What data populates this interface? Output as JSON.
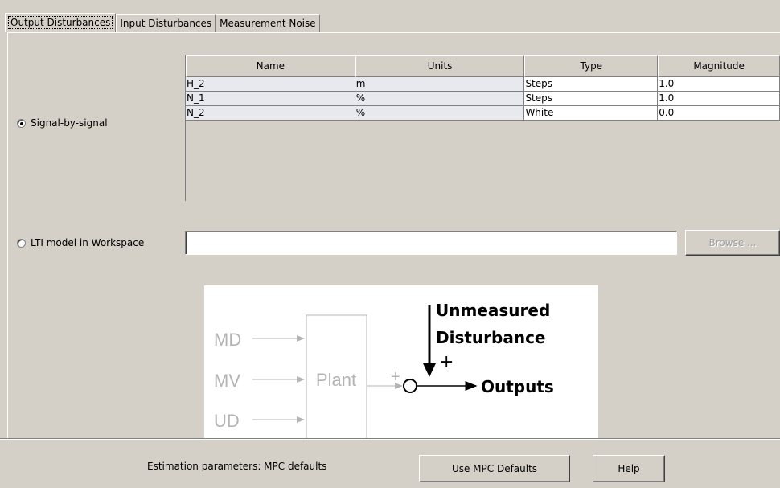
{
  "tabs": [
    {
      "label": "Output Disturbances",
      "active": true
    },
    {
      "label": "Input Disturbances",
      "active": false
    },
    {
      "label": "Measurement Noise",
      "active": false
    }
  ],
  "signal_option": {
    "label": "Signal-by-signal",
    "selected": true
  },
  "lti_option": {
    "label": "LTI model in Workspace",
    "selected": false
  },
  "table": {
    "columns": [
      "Name",
      "Units",
      "Type",
      "Magnitude"
    ],
    "rows": [
      [
        "H_2",
        "m",
        "Steps",
        "1.0"
      ],
      [
        "N_1",
        "%",
        "Steps",
        "1.0"
      ],
      [
        "N_2",
        "%",
        "White",
        "0.0"
      ]
    ]
  },
  "workspace_field": {
    "value": ""
  },
  "browse_button": {
    "label": "Browse ...",
    "enabled": false
  },
  "diagram": {
    "inputs": [
      "MD",
      "MV",
      "UD"
    ],
    "plant_label": "Plant",
    "plus_left": "+",
    "plus_top": "+",
    "disturbance_line1": "Unmeasured",
    "disturbance_line2": "Disturbance",
    "outputs_label": "Outputs"
  },
  "footer": {
    "estimation_label": "Estimation parameters:  MPC defaults",
    "use_defaults_button": "Use MPC Defaults",
    "help_button": "Help"
  },
  "colors": {
    "dialog_bg": "#d4d0c8",
    "readonly_cell": "#e8e8ef",
    "diagram_gray": "#b4b4b4"
  }
}
